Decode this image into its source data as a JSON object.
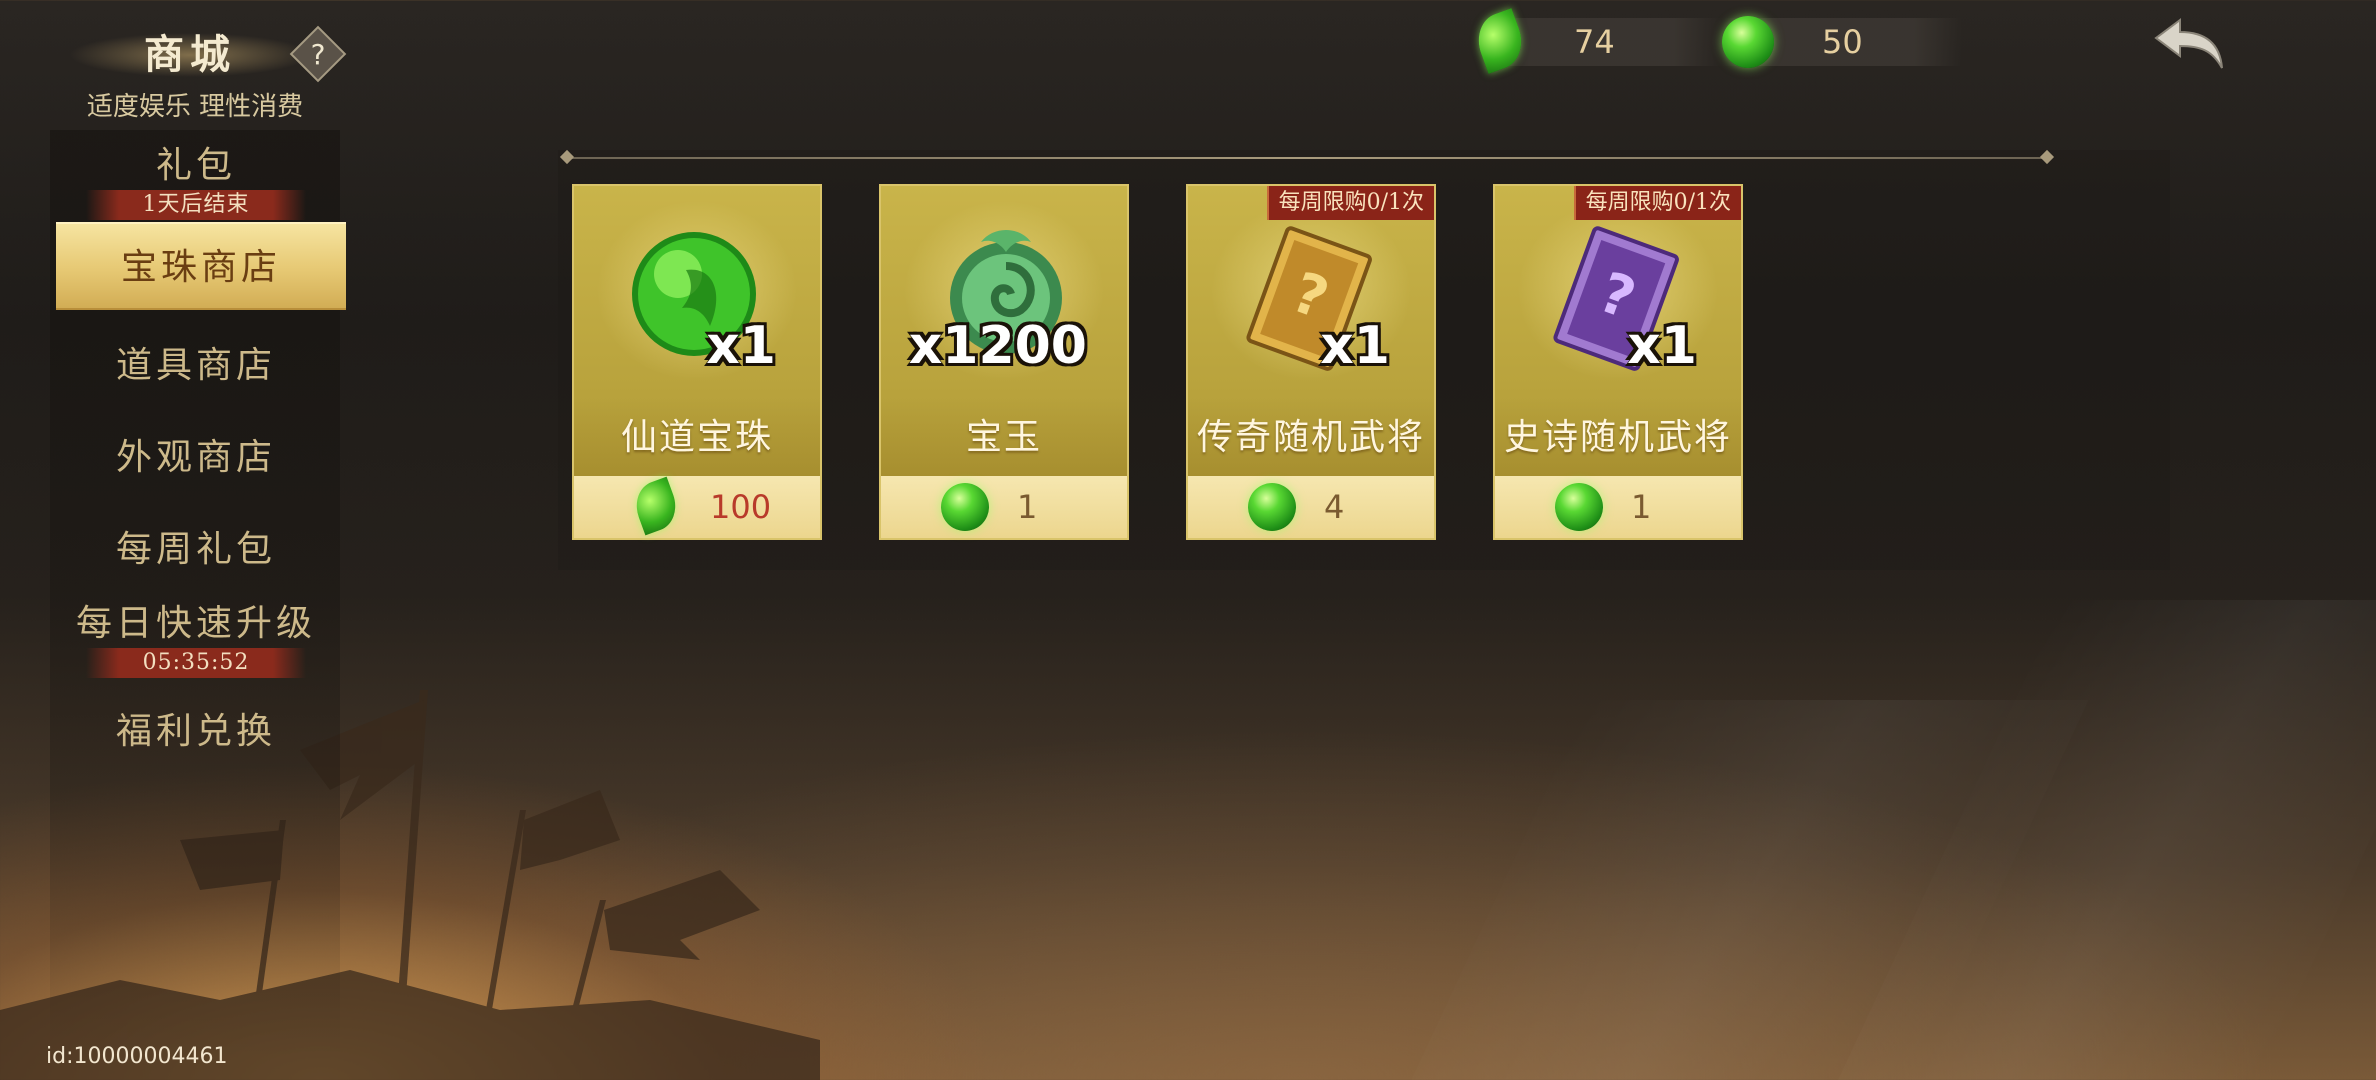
{
  "header": {
    "title": "商城",
    "help_icon": "?",
    "subtitle": "适度娱乐 理性消费",
    "back_icon": "back-arrow-icon"
  },
  "currencies": [
    {
      "icon": "jade-leaf-icon",
      "amount": "74"
    },
    {
      "icon": "jade-orb-icon",
      "amount": "50"
    }
  ],
  "sidebar": {
    "items": [
      {
        "label": "礼包",
        "badge": "1天后结束"
      },
      {
        "label": "宝珠商店",
        "active": true
      },
      {
        "label": "道具商店"
      },
      {
        "label": "外观商店"
      },
      {
        "label": "每周礼包"
      },
      {
        "label": "每日快速升级",
        "badge": "05:35:52"
      },
      {
        "label": "福利兑换"
      }
    ]
  },
  "shop": {
    "items": [
      {
        "name": "仙道宝珠",
        "quantity": "x1",
        "price_icon": "jade-leaf-icon",
        "price": "100",
        "limit": ""
      },
      {
        "name": "宝玉",
        "quantity": "x1200",
        "price_icon": "jade-orb-icon",
        "price": "1",
        "limit": ""
      },
      {
        "name": "传奇随机武将",
        "quantity": "x1",
        "price_icon": "jade-orb-icon",
        "price": "4",
        "limit": "每周限购0/1次"
      },
      {
        "name": "史诗随机武将",
        "quantity": "x1",
        "price_icon": "jade-orb-icon",
        "price": "1",
        "limit": "每周限购0/1次"
      }
    ]
  },
  "footer": {
    "user_id": "id:10000004461"
  },
  "colors": {
    "accent_gold": "#e6c873",
    "card_gold": "#c9b44a",
    "badge_red": "#8a2418",
    "jade_green": "#39b51f"
  }
}
